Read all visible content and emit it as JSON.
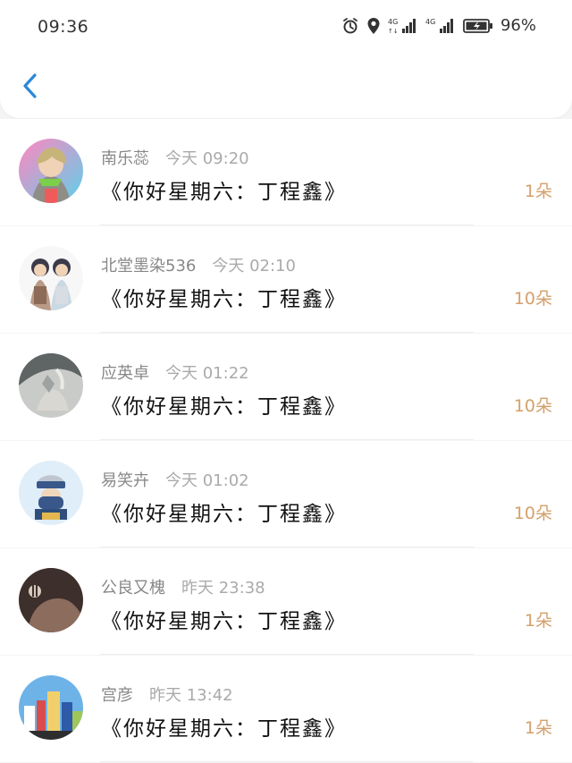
{
  "status_bar": {
    "time": "09:36",
    "battery_percent": "96%",
    "icons": [
      "alarm-icon",
      "location-icon",
      "signal-4g-icon",
      "signal-4g-icon",
      "battery-icon"
    ]
  },
  "header": {
    "back_icon": "chevron-left-icon",
    "accent_color": "#2b88d8"
  },
  "items": [
    {
      "name": "南乐蕊",
      "time": "今天 09:20",
      "title": "《你好星期六：丁程鑫》",
      "count": "1朵",
      "avatar_colors": [
        "#c7b47a",
        "#7ccf48",
        "#8f8d86"
      ]
    },
    {
      "name": "北堂墨染536",
      "time": "今天 02:10",
      "title": "《你好星期六：丁程鑫》",
      "count": "10朵",
      "avatar_colors": [
        "#f2f2f2",
        "#3c3a4a",
        "#b89a86"
      ]
    },
    {
      "name": "应英卓",
      "time": "今天 01:22",
      "title": "《你好星期六：丁程鑫》",
      "count": "10朵",
      "avatar_colors": [
        "#9ea3a1",
        "#d9d7d1",
        "#5f6564"
      ]
    },
    {
      "name": "易笑卉",
      "time": "今天 01:02",
      "title": "《你好星期六：丁程鑫》",
      "count": "10朵",
      "avatar_colors": [
        "#dfeef9",
        "#39578a",
        "#bfc6cf"
      ]
    },
    {
      "name": "公良又槐",
      "time": "昨天 23:38",
      "title": "《你好星期六：丁程鑫》",
      "count": "1朵",
      "avatar_colors": [
        "#3d2f2b",
        "#8b6c5d",
        "#d7c9bc"
      ]
    },
    {
      "name": "宫彦",
      "time": "昨天 13:42",
      "title": "《你好星期六：丁程鑫》",
      "count": "1朵",
      "avatar_colors": [
        "#6db3e8",
        "#f1d06c",
        "#d94c4c"
      ]
    }
  ],
  "colors": {
    "count": "#d4a06a",
    "meta": "#888888",
    "background": "#f4f4f4"
  }
}
